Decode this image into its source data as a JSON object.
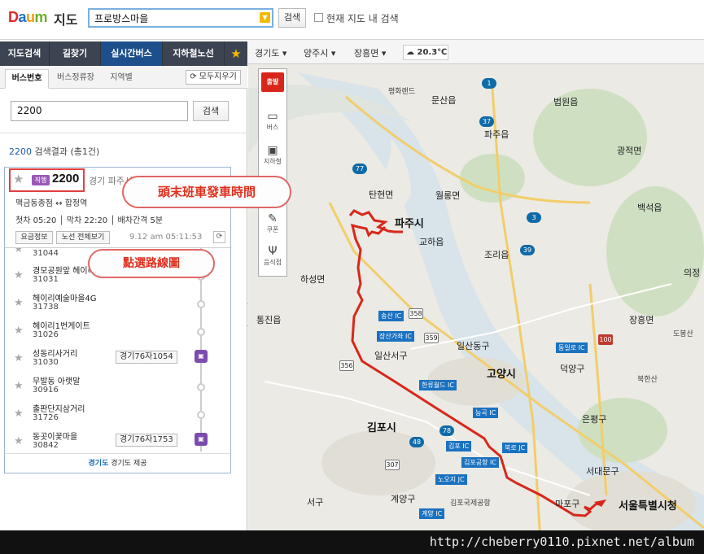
{
  "app": {
    "logo": {
      "d": "D",
      "a": "a",
      "u": "u",
      "m": "m"
    },
    "title": "지도"
  },
  "search": {
    "value": "프로방스마을",
    "button": "검색",
    "option_label": "현재 지도 내 검색"
  },
  "nav_tabs": [
    "지도검색",
    "길찾기",
    "실시간버스",
    "지하철노선"
  ],
  "sub_tabs": [
    "버스번호",
    "버스정류장",
    "지역별"
  ],
  "clear_all": "모두지우기",
  "bus_search": {
    "value": "2200",
    "button": "검색"
  },
  "result": {
    "query": "2200",
    "text": " 검색결과 (총1건)"
  },
  "route": {
    "badge": "직행",
    "number": "2200",
    "region": "경기 파주시",
    "ends": "맥금동종점 ↔ 합정역",
    "times": "첫차 05:20 │ 막차 22:20 │ 배차간격 5분",
    "fare_button": "요금정보",
    "map_button": "노선 전체보기",
    "updated": "9.12 am 05:11:53",
    "stops": [
      {
        "name": "",
        "id": "31044",
        "plate": ""
      },
      {
        "name": "경모공원앞 헤이리마을11",
        "id": "31031",
        "plate": ""
      },
      {
        "name": "헤이리예술마을4G",
        "id": "31738",
        "plate": ""
      },
      {
        "name": "헤이리1번게이트",
        "id": "31026",
        "plate": ""
      },
      {
        "name": "성동리사거리",
        "id": "31030",
        "plate": "경기76자1054"
      },
      {
        "name": "무발동 아랫말",
        "id": "30916",
        "plate": ""
      },
      {
        "name": "출판단지삼거리",
        "id": "31726",
        "plate": ""
      },
      {
        "name": "동곳이꽃마을",
        "id": "30842",
        "plate": "경기76자1753"
      }
    ],
    "provider_logo": "경기도",
    "provider": " 경기도 제공"
  },
  "map": {
    "crumbs": [
      "경기도 ▾",
      "양주시 ▾",
      "장흥면 ▾"
    ],
    "weather": "20.3℃",
    "tools": {
      "depart": "출발",
      "bus": "버스",
      "subway": "지하철",
      "coupon": "쿠폰",
      "food": "음식점"
    },
    "labels": [
      "평화랜드",
      "문산읍",
      "파주시",
      "법원읍",
      "광적면",
      "파주읍",
      "월롱면",
      "탄현면",
      "조리읍",
      "백석읍",
      "교하읍",
      "하성면",
      "의정",
      "장흥면",
      "도봉산",
      "통진읍",
      "일산서구",
      "일산동구",
      "고양시",
      "덕양구",
      "북한산",
      "김포시",
      "은평구",
      "서대문구",
      "서울특별시청",
      "계양구",
      "서구",
      "마포구",
      "김포국제공항"
    ],
    "ics": [
      "송산 IC",
      "장산가좌 IC",
      "한류월드 IC",
      "능곡 IC",
      "김포 IC",
      "북로 JC",
      "김포공항 IC",
      "노오지 JC",
      "계양 IC",
      "동일로 IC"
    ],
    "routes": [
      "1",
      "37",
      "77",
      "356",
      "358",
      "359",
      "78",
      "48",
      "307",
      "39",
      "100",
      "3"
    ]
  },
  "callouts": {
    "first_last": "頭末班車發車時間",
    "select_route": "點選路線圖"
  },
  "watermark": "http://cheberry0110.pixnet.net/album"
}
